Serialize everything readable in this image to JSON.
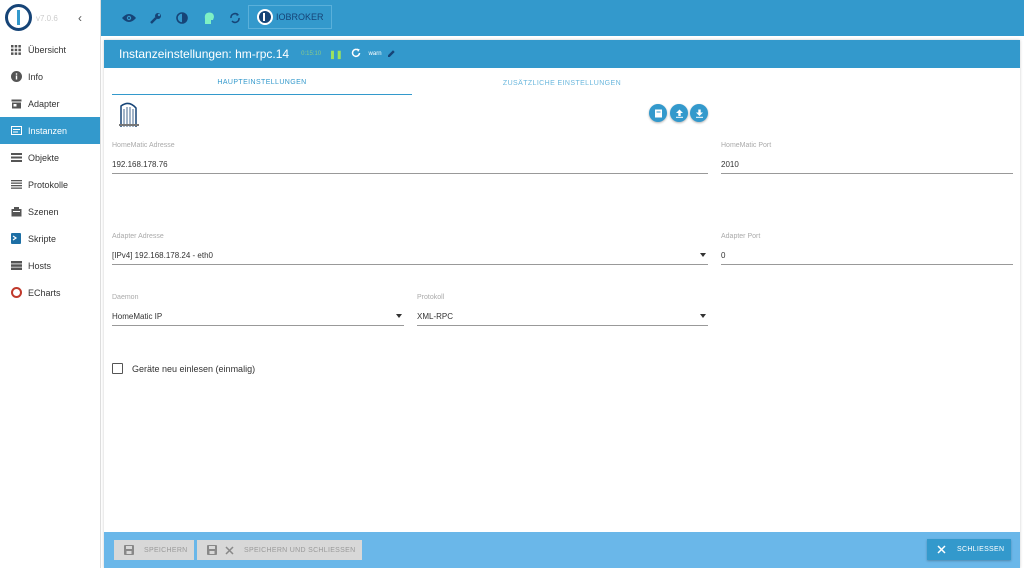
{
  "sidebar": {
    "version": "v7.0.6",
    "items": [
      {
        "label": "Übersicht",
        "icon": "grid-icon"
      },
      {
        "label": "Info",
        "icon": "info-icon"
      },
      {
        "label": "Adapter",
        "icon": "store-icon"
      },
      {
        "label": "Instanzen",
        "icon": "instances-icon",
        "active": true
      },
      {
        "label": "Objekte",
        "icon": "list-icon"
      },
      {
        "label": "Protokolle",
        "icon": "log-icon"
      },
      {
        "label": "Szenen",
        "icon": "scenes-icon"
      },
      {
        "label": "Skripte",
        "icon": "script-icon"
      },
      {
        "label": "Hosts",
        "icon": "hosts-icon"
      },
      {
        "label": "ECharts",
        "icon": "echarts-icon"
      }
    ]
  },
  "topbar": {
    "iobroker_label": "IOBROKER"
  },
  "panel": {
    "title": "Instanzeinstellungen: hm-rpc.14",
    "status_text": "0:15:10",
    "log_level": "warn"
  },
  "tabs": [
    "HAUPTEINSTELLUNGEN",
    "ZUSÄTZLICHE EINSTELLUNGEN"
  ],
  "fields": {
    "homematic_address": {
      "label": "HomeMatic Adresse",
      "value": "192.168.178.76"
    },
    "homematic_port": {
      "label": "HomeMatic Port",
      "value": "2010"
    },
    "adapter_address": {
      "label": "Adapter Adresse",
      "value": "[IPv4] 192.168.178.24 - eth0"
    },
    "adapter_port": {
      "label": "Adapter Port",
      "value": "0"
    },
    "daemon": {
      "label": "Daemon",
      "value": "HomeMatic IP"
    },
    "protocol": {
      "label": "Protokoll",
      "value": "XML-RPC"
    }
  },
  "checkbox": {
    "label": "Geräte neu einlesen (einmalig)",
    "checked": false
  },
  "footer": {
    "save": "SPEICHERN",
    "save_close": "SPEICHERN UND SCHLIESSEN",
    "close": "SCHLIESSEN"
  },
  "colors": {
    "accent": "#3399cc",
    "brand": "#164477",
    "footer": "#6ab7e9"
  }
}
